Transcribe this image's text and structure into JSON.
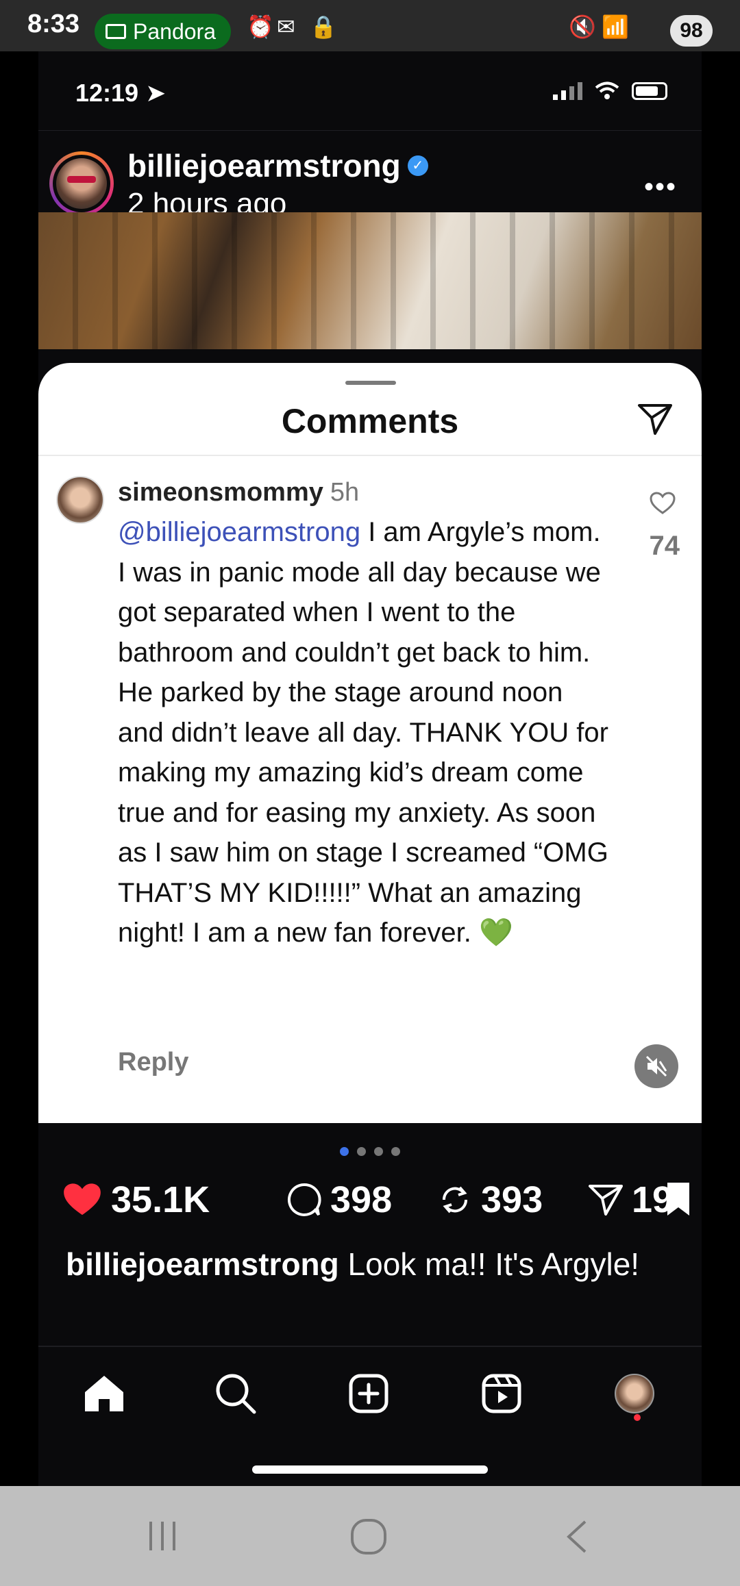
{
  "android_status": {
    "time": "8:33",
    "pandora_label": "Pandora",
    "battery": "98"
  },
  "ios_status": {
    "time": "12:19"
  },
  "post": {
    "username": "billiejoearmstrong",
    "time_ago": "2 hours ago",
    "stats": {
      "likes": "35.1K",
      "comments": "398",
      "reposts": "393",
      "shares": "19"
    },
    "caption_user": "billiejoearmstrong",
    "caption_text": " Look ma!! It's Argyle!"
  },
  "comments_sheet": {
    "title": "Comments",
    "comment": {
      "username": "simeonsmommy",
      "age": "5h",
      "mention": "@billiejoearmstrong",
      "text": " I am Argyle’s mom. I was in panic mode all day because we got separated when I went to the bathroom and couldn’t get back to him. He parked by the stage around noon and didn’t leave all day. THANK YOU for making my amazing kid’s dream come true and for easing my anxiety. As soon as I saw him on stage I screamed “OMG THAT’S MY KID!!!!!” What an amazing night! I am a new fan forever. ",
      "emoji": "💚",
      "like_count": "74",
      "reply_label": "Reply"
    }
  },
  "carousel": {
    "count": 4,
    "active": 0
  },
  "icons": {
    "accent_blue": "#3d51b8",
    "like_red": "#ff3040",
    "verified_blue": "#3b99f5"
  }
}
